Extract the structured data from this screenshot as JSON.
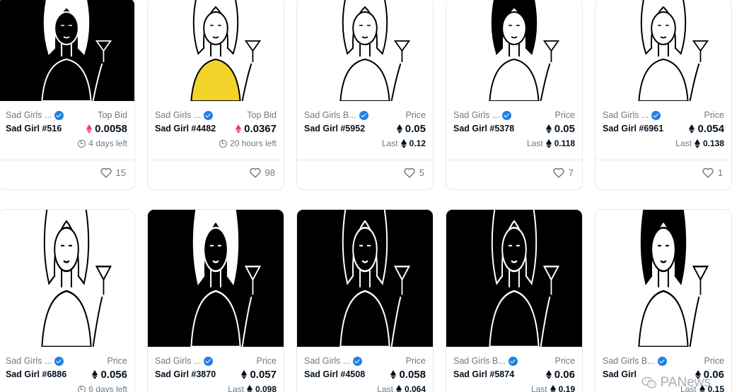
{
  "row1": [
    {
      "collection": "Sad Girls ...",
      "name": "Sad Girl #516",
      "price_label": "Top Bid",
      "price": "0.0058",
      "currency": "weth",
      "sub": "4 days left",
      "sub_type": "time",
      "likes": "15",
      "bg": "black"
    },
    {
      "collection": "Sad Girls ...",
      "name": "Sad Girl #4482",
      "price_label": "Top Bid",
      "price": "0.0367",
      "currency": "weth",
      "sub": "20 hours left",
      "sub_type": "time",
      "likes": "98",
      "bg": "white"
    },
    {
      "collection": "Sad Girls B...",
      "name": "Sad Girl #5952",
      "price_label": "Price",
      "price": "0.05",
      "currency": "eth",
      "sub_label": "Last",
      "sub": "0.12",
      "sub_type": "last",
      "likes": "5",
      "bg": "white"
    },
    {
      "collection": "Sad Girls ...",
      "name": "Sad Girl #5378",
      "price_label": "Price",
      "price": "0.05",
      "currency": "eth",
      "sub_label": "Last",
      "sub": "0.118",
      "sub_type": "last",
      "likes": "7",
      "bg": "white"
    },
    {
      "collection": "Sad Girls ...",
      "name": "Sad Girl #6961",
      "price_label": "Price",
      "price": "0.054",
      "currency": "eth",
      "sub_label": "Last",
      "sub": "0.138",
      "sub_type": "last",
      "likes": "1",
      "bg": "white"
    }
  ],
  "row2": [
    {
      "collection": "Sad Girls ...",
      "name": "Sad Girl #6886",
      "price_label": "Price",
      "price": "0.056",
      "currency": "eth",
      "sub": "6 days left",
      "sub_type": "time",
      "bg": "white"
    },
    {
      "collection": "Sad Girls ...",
      "name": "Sad Girl #3870",
      "price_label": "Price",
      "price": "0.057",
      "currency": "eth",
      "sub_label": "Last",
      "sub": "0.098",
      "sub_type": "last",
      "bg": "black"
    },
    {
      "collection": "Sad Girls ...",
      "name": "Sad Girl #4508",
      "price_label": "Price",
      "price": "0.058",
      "currency": "eth",
      "sub_label": "Last",
      "sub": "0.064",
      "sub_type": "last",
      "bg": "black"
    },
    {
      "collection": "Sad Girls B...",
      "name": "Sad Girl #5874",
      "price_label": "Price",
      "price": "0.06",
      "currency": "eth",
      "sub_label": "Last",
      "sub": "0.19",
      "sub_type": "last",
      "bg": "black"
    },
    {
      "collection": "Sad Girls B...",
      "name": "Sad Girl",
      "price_label": "Price",
      "price": "0.06",
      "currency": "eth",
      "sub_label": "Last",
      "sub": "0.15",
      "sub_type": "last",
      "bg": "white"
    }
  ],
  "watermark": {
    "text": "PANews",
    "icon": "wechat-icon"
  },
  "colors": {
    "verified": "#2081e2",
    "weth": "#ec407a",
    "muted": "#707a83",
    "text": "#04111d",
    "border": "#e5e8eb"
  }
}
